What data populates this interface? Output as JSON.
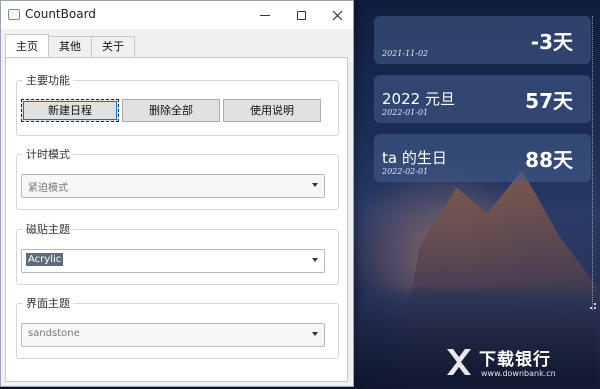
{
  "window": {
    "title": "CountBoard"
  },
  "tabs": [
    {
      "label": "主页",
      "active": true
    },
    {
      "label": "其他",
      "active": false
    },
    {
      "label": "关于",
      "active": false
    }
  ],
  "groups": {
    "main_functions": {
      "label": "主要功能",
      "buttons": [
        "新建日程",
        "删除全部",
        "使用说明"
      ]
    },
    "timer_mode": {
      "label": "计时模式",
      "value": "紧迫模式"
    },
    "tile_theme": {
      "label": "磁贴主题",
      "value": "Acrylic"
    },
    "ui_theme": {
      "label": "界面主题",
      "value": "sandstone"
    }
  },
  "tiles": [
    {
      "title": "",
      "date": "2021-11-02",
      "count": "-3天"
    },
    {
      "title": "2022 元旦",
      "date": "2022-01-01",
      "count": "57天"
    },
    {
      "title": "ta 的生日",
      "date": "2022-02-01",
      "count": "88天"
    }
  ],
  "watermark": {
    "text": "下载银行",
    "url": "www.downbank.cn"
  },
  "colors": {
    "accent": "#0078d7",
    "tile_bg": "#465f8c",
    "desktop": "#1c2d57"
  }
}
